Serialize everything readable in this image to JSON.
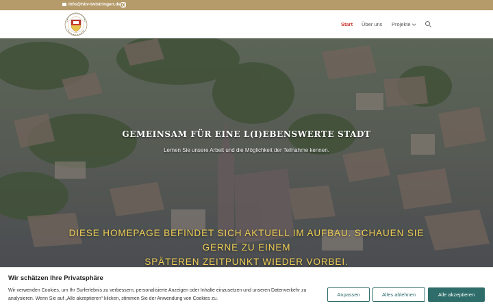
{
  "topbar": {
    "email": "info@hbv-twistringen.de",
    "email_icon": "envelope-icon",
    "social_icon": "instagram-icon"
  },
  "header": {
    "logo_icon": "association-crest-logo",
    "nav": [
      {
        "label": "Start",
        "active": true
      },
      {
        "label": "Über uns",
        "active": false
      },
      {
        "label": "Projekte",
        "active": false,
        "dropdown": true
      }
    ],
    "search_icon": "search-icon"
  },
  "hero": {
    "title": "GEMEINSAM FÜR EINE L(I)EBENSWERTE STADT",
    "subtitle": "Lernen Sie unsere Arbeit und die Möglichkeit der Teilnahme kennen.",
    "notice_line1": "DIESE HOMEPAGE BEFINDET SICH AKTUELL IM AUFBAU. SCHAUEN SIE GERNE ZU EINEM",
    "notice_line2": "SPÄTEREN ZEITPUNKT WIEDER VORBEI."
  },
  "cookie": {
    "title": "Wir schätzen Ihre Privatsphäre",
    "text": "Wir verwenden Cookies, um Ihr Surferlebnis zu verbessern, personalisierte Anzeigen oder Inhalte einzusetzen und unseren Datenverkehr zu analysieren. Wenn Sie auf „Alle akzeptieren“ klicken, stimmen Sie der Anwendung von Cookies zu.",
    "btn_adjust": "Anpassen",
    "btn_reject": "Alles ablehnen",
    "btn_accept": "Alle akzeptieren"
  },
  "colors": {
    "topbar": "#b59a6a",
    "nav_active": "#c8392f",
    "notice": "#f0cf55",
    "cookie_accent": "#2e6d6a"
  }
}
